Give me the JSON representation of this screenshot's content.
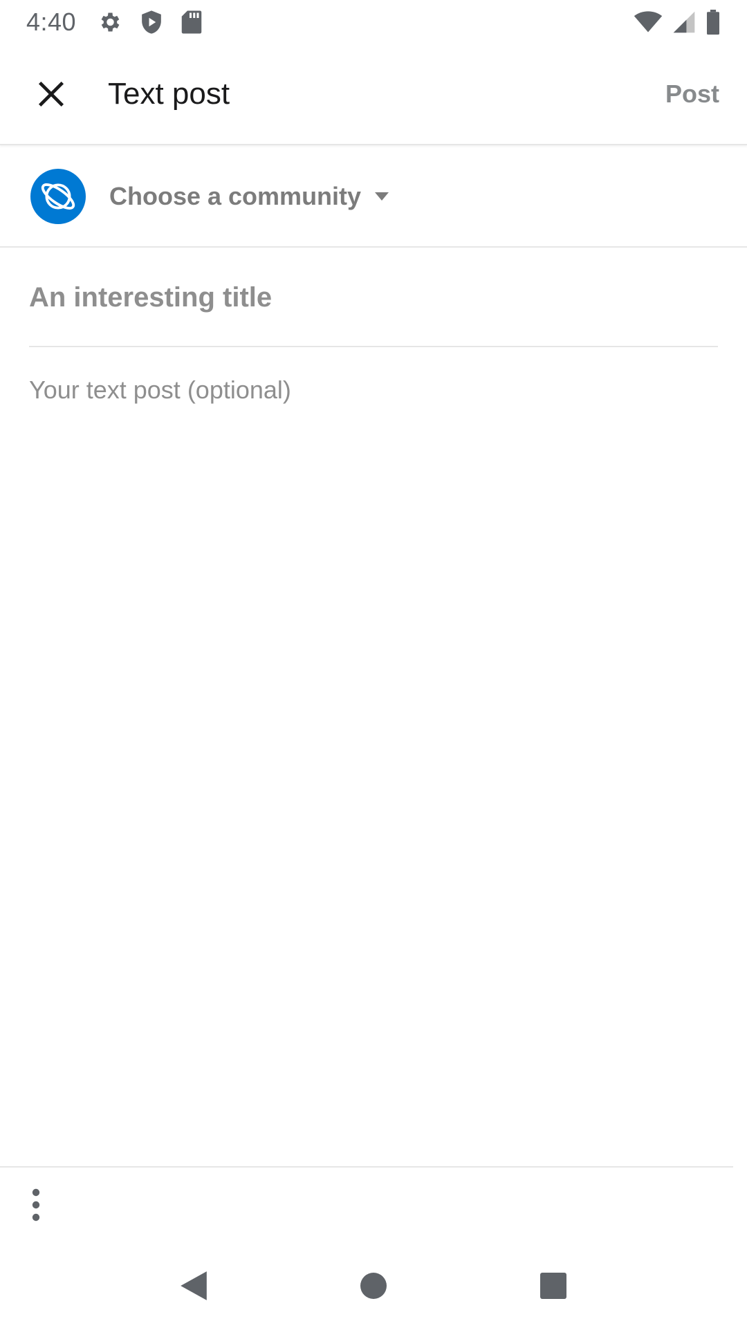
{
  "status_bar": {
    "time": "4:40",
    "left_icons": [
      "settings-icon",
      "play-protect-icon",
      "sd-card-icon"
    ],
    "right_icons": [
      "wifi-icon",
      "cell-signal-icon",
      "battery-icon"
    ]
  },
  "app_bar": {
    "title": "Text post",
    "post_label": "Post",
    "close_icon": "close-icon"
  },
  "community": {
    "label": "Choose a community",
    "avatar_icon": "planet-icon",
    "caret_icon": "caret-down-icon",
    "accent_color": "#0079d3"
  },
  "title_field": {
    "placeholder": "An interesting title",
    "value": ""
  },
  "body_field": {
    "placeholder": "Your text post (optional)",
    "value": ""
  },
  "toolbar": {
    "more_icon": "more-vertical-icon"
  },
  "nav_bar": {
    "icons": [
      "back-icon",
      "home-icon",
      "recents-icon"
    ]
  }
}
